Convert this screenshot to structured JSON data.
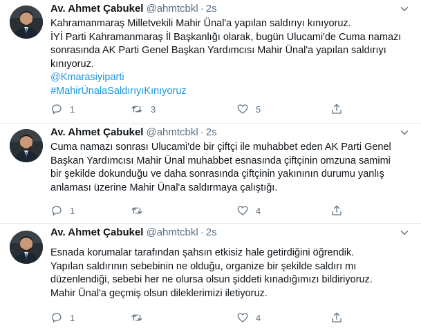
{
  "tweets": [
    {
      "name": "Av. Ahmet Çabukel",
      "handle": "@ahmtcbkl",
      "separator": "·",
      "time": "2s",
      "lines": [
        "Kahramanmaraş Milletvekili Mahir Ünal'a yapılan saldırıyı kınıyoruz.",
        "İYİ Parti Kahramanmaraş İl Başkanlığı olarak, bugün Ulucami'de Cuma namazı",
        "sonrasında AK Parti Genel Başkan Yardımcısı Mahir Ünal'a yapılan saldırıyı",
        "kınıyoruz."
      ],
      "mention": "@Kmarasiyiparti",
      "hashtag": "#MahirÜnalaSaldırıyıKınıyoruz",
      "reply_count": "1",
      "retweet_count": "3",
      "like_count": "5"
    },
    {
      "name": "Av. Ahmet Çabukel",
      "handle": "@ahmtcbkl",
      "separator": "·",
      "time": "2s",
      "lines": [
        "Cuma namazı sonrası Ulucami'de bir çiftçi ile muhabbet eden AK Parti Genel",
        "Başkan Yardımcısı Mahir Ünal muhabbet esnasında çiftçinin omzuna samimi",
        "bir şekilde dokunduğu ve daha sonrasında çiftçinin yakınının durumu yanlış",
        "anlaması üzerine Mahir Ünal'a saldırmaya çalıştığı."
      ],
      "reply_count": "1",
      "retweet_count": "",
      "like_count": "4"
    },
    {
      "name": "Av. Ahmet Çabukel",
      "handle": "@ahmtcbkl",
      "separator": "·",
      "time": "2s",
      "lines": [
        "Esnada korumalar tarafından şahsın etkisiz hale getirdiğini öğrendik.",
        "Yapılan saldırının sebebinin ne olduğu, organize bir şekilde saldırı mı",
        "düzenlendiği, sebebi her ne olursa olsun şiddeti kınadığımızı bildiriyoruz.",
        "Mahir Ünal'a geçmiş olsun dileklerimizi iletiyoruz."
      ],
      "reply_count": "1",
      "retweet_count": "",
      "like_count": "4"
    }
  ],
  "icons": {
    "more": "chevron-down-icon",
    "reply": "reply-icon",
    "retweet": "retweet-icon",
    "like": "heart-icon",
    "share": "share-icon"
  },
  "colors": {
    "text": "#0f1419",
    "secondary": "#5b7083",
    "link": "#1b95e0",
    "divider": "#e6ecf0"
  }
}
